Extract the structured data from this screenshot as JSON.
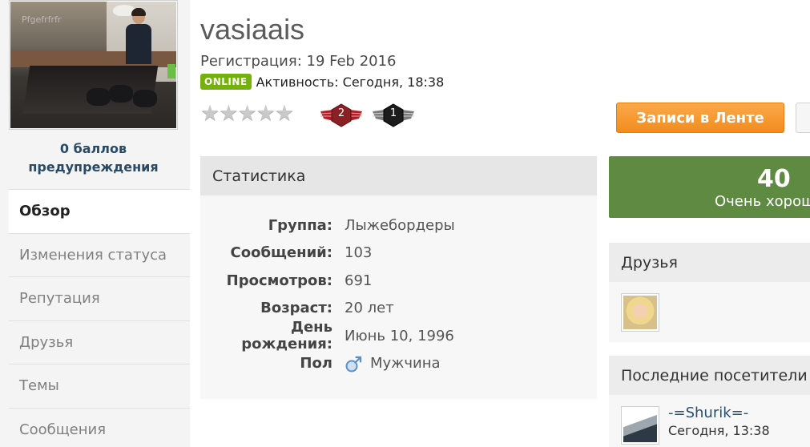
{
  "profile": {
    "username": "vasiaais",
    "registration": "Регистрация: 19 Feb 2016",
    "online_badge": "ONLINE",
    "activity": "Активность: Сегодня, 18:38",
    "avatar_watermark": "Pfgefrfrfr",
    "reputation_text": "0 баллов предупреждения",
    "rating_stars_filled": 0,
    "rating_stars_total": 5
  },
  "badges": [
    {
      "number": "2",
      "color": "#8a1f24"
    },
    {
      "number": "1",
      "color": "#1c1c1c"
    }
  ],
  "sidebar": {
    "items": [
      {
        "label": "Обзор",
        "active": true
      },
      {
        "label": "Изменения статуса",
        "active": false
      },
      {
        "label": "Репутация",
        "active": false
      },
      {
        "label": "Друзья",
        "active": false
      },
      {
        "label": "Темы",
        "active": false
      },
      {
        "label": "Сообщения",
        "active": false
      }
    ]
  },
  "actions": {
    "feed_button": "Записи в Ленте"
  },
  "stats": {
    "title": "Статистика",
    "rows": [
      {
        "label": "Группа:",
        "value": "Лыжебордеры"
      },
      {
        "label": "Сообщений:",
        "value": "103"
      },
      {
        "label": "Просмотров:",
        "value": "691"
      },
      {
        "label": "Возраст:",
        "value": "20 лет"
      },
      {
        "label": "День рождения:",
        "value": "Июнь 10, 1996"
      },
      {
        "label": "Пол",
        "value": "Мужчина",
        "icon": "male-icon"
      }
    ]
  },
  "reputation": {
    "score": "40",
    "label": "Очень хорошая"
  },
  "friends": {
    "title": "Друзья"
  },
  "visitors": {
    "title": "Последние посетители",
    "items": [
      {
        "name": "-=Shurik=-",
        "time": "Сегодня, 13:38"
      }
    ]
  },
  "colors": {
    "accent_orange": "#f28c1c",
    "online_green": "#74b10d",
    "reputation_green": "#5f8a41",
    "link_blue": "#2a4e6b"
  }
}
